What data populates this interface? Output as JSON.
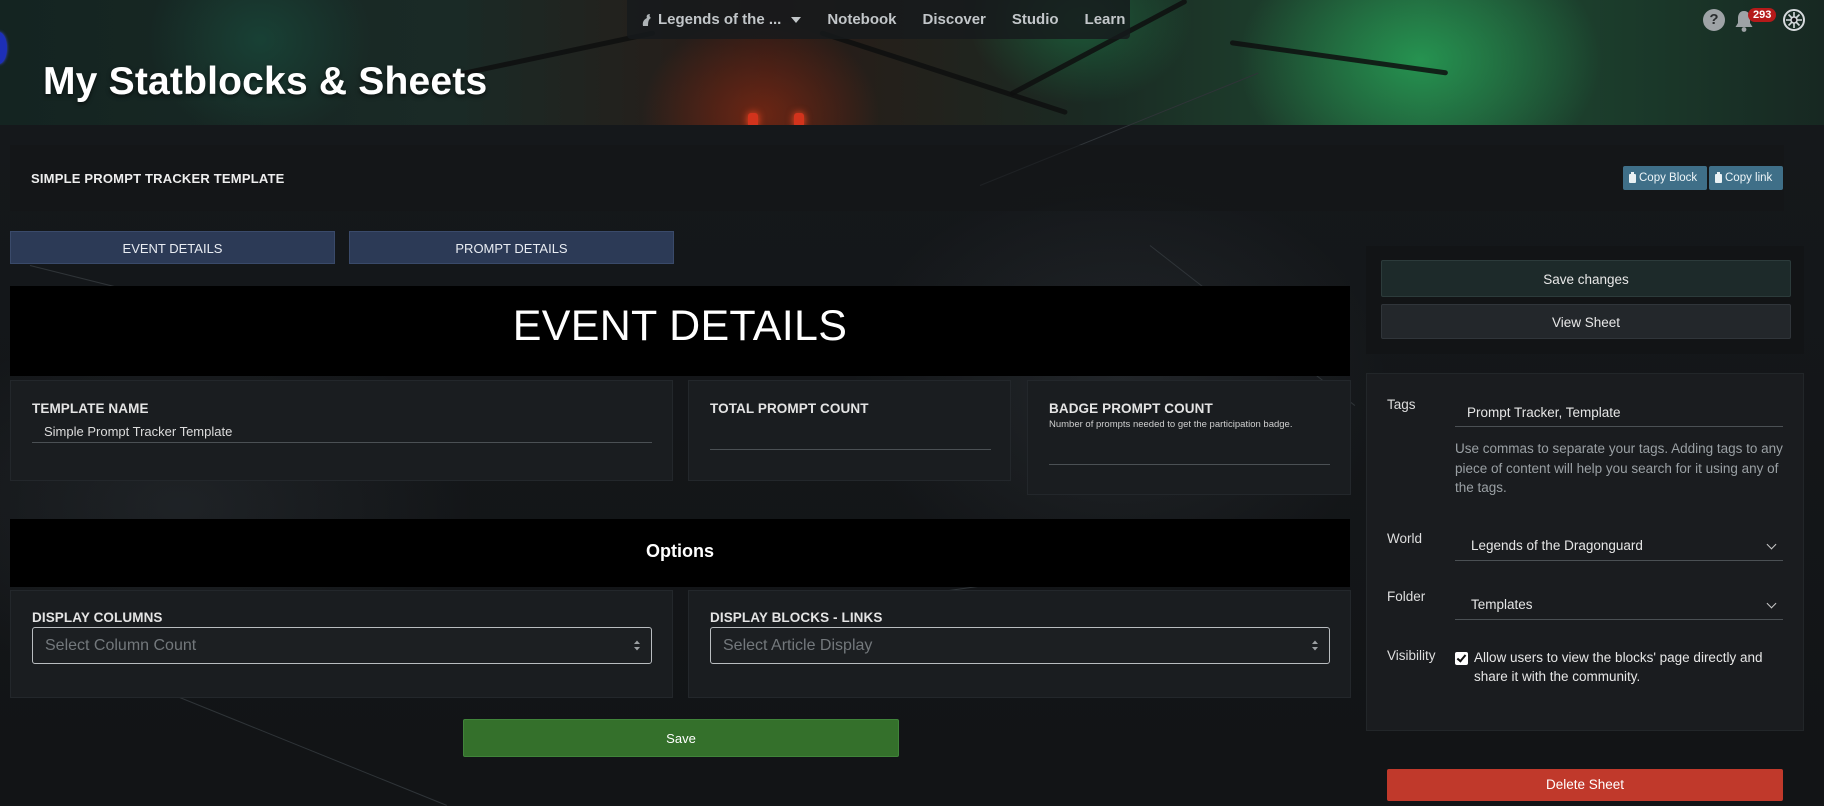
{
  "nav": {
    "world_label": "Legends of the ...",
    "items": [
      "Notebook",
      "Discover",
      "Studio",
      "Learn"
    ],
    "notification_count": "293"
  },
  "page": {
    "title": "My Statblocks & Sheets"
  },
  "sheet": {
    "name": "SIMPLE PROMPT TRACKER TEMPLATE",
    "copy_block_label": "Copy Block",
    "copy_link_label": "Copy link"
  },
  "tabs": [
    {
      "label": "EVENT DETAILS"
    },
    {
      "label": "PROMPT DETAILS"
    }
  ],
  "event_section": {
    "title": "EVENT DETAILS",
    "template_name": {
      "label": "TEMPLATE NAME",
      "value": "Simple Prompt Tracker Template"
    },
    "total_prompt_count": {
      "label": "TOTAL PROMPT COUNT",
      "value": ""
    },
    "badge_prompt_count": {
      "label": "BADGE PROMPT COUNT",
      "help": "Number of prompts needed to get the participation badge.",
      "value": ""
    }
  },
  "options_section": {
    "title": "Options",
    "display_columns": {
      "label": "DISPLAY COLUMNS",
      "placeholder": "Select Column Count"
    },
    "display_blocks_links": {
      "label": "DISPLAY BLOCKS - LINKS",
      "placeholder": "Select Article Display"
    }
  },
  "save_label": "Save",
  "sidebar": {
    "save_changes_label": "Save changes",
    "view_sheet_label": "View Sheet",
    "tags": {
      "label": "Tags",
      "value": "Prompt Tracker, Template",
      "help": "Use commas to separate your tags. Adding tags to any piece of content will help you search for it using any of the tags."
    },
    "world": {
      "label": "World",
      "value": "Legends of the Dragonguard"
    },
    "folder": {
      "label": "Folder",
      "value": "Templates"
    },
    "visibility": {
      "label": "Visibility",
      "checked": true,
      "text": "Allow users to view the blocks' page directly and share it with the community."
    },
    "delete_label": "Delete Sheet"
  },
  "colors": {
    "tab_bg": "#2c3a56",
    "save_green": "#34702b",
    "delete_red": "#c0392b",
    "copy_btn_blue": "#3f6f88",
    "badge_red": "#b51a1a"
  }
}
